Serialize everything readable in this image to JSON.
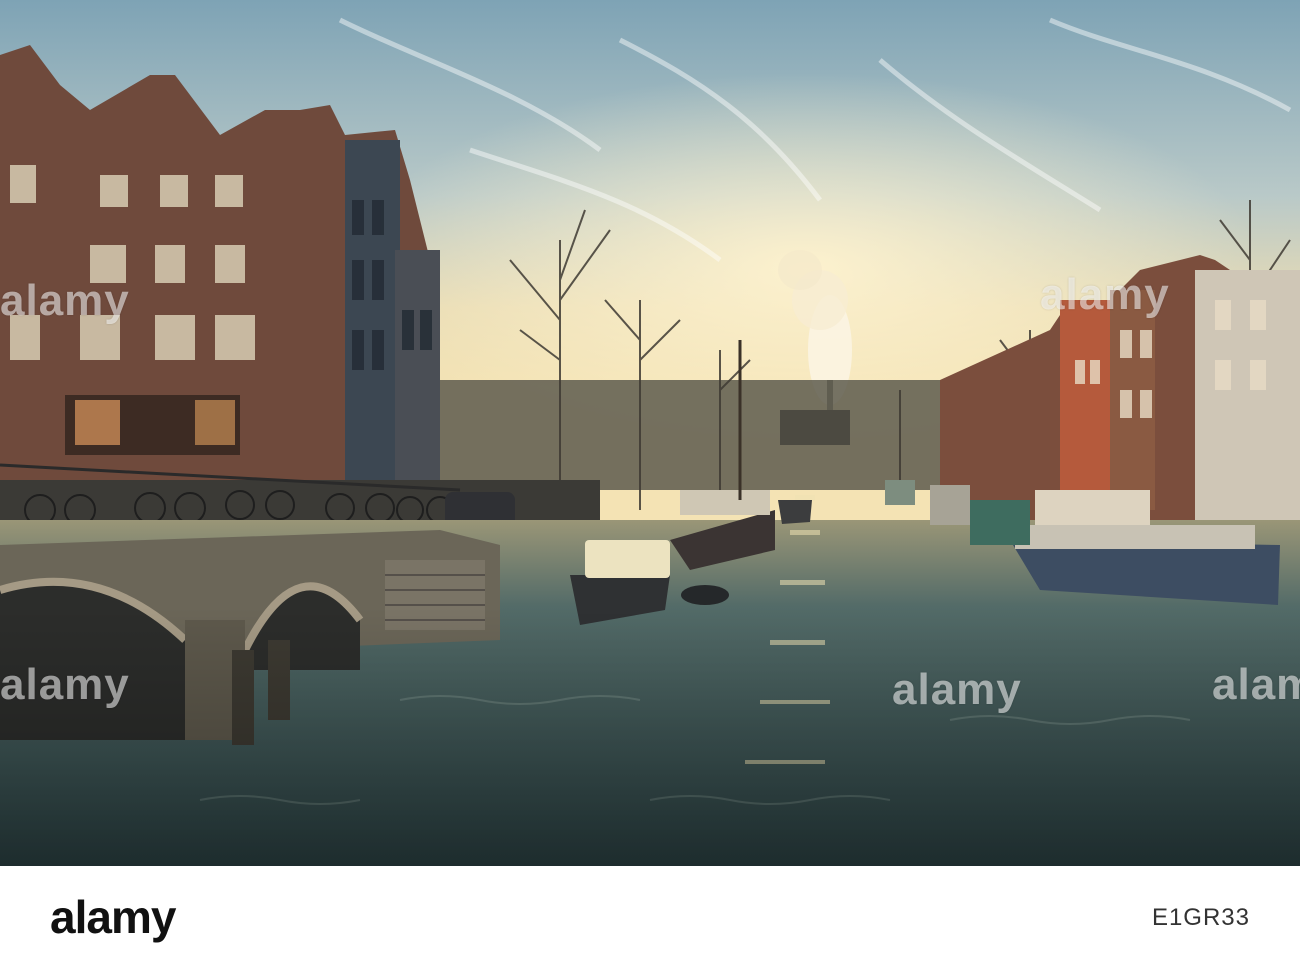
{
  "image": {
    "description_hidden": "",
    "watermark": "alamy"
  },
  "footer": {
    "brand": "alamy",
    "stock_id": "E1GR33"
  },
  "colors": {
    "sky_top": "#6f9bb3",
    "sky_glow": "#f2dca8",
    "water": "#3f5a5c",
    "brick": "#7a4a3c",
    "footer_bg": "#ffffff",
    "brand_text": "#111111"
  }
}
